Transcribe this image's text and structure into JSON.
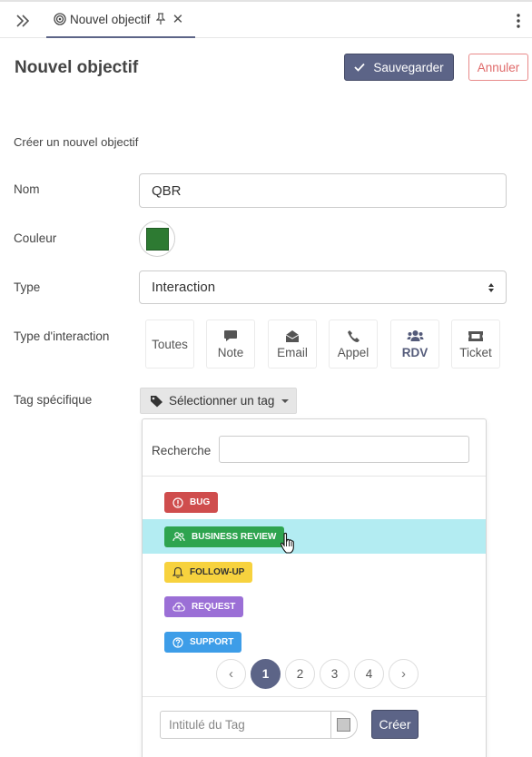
{
  "tab": {
    "label": "Nouvel objectif"
  },
  "page": {
    "title": "Nouvel objectif"
  },
  "actions": {
    "save": "Sauvegarder",
    "cancel": "Annuler"
  },
  "form": {
    "subtitle": "Créer un nouvel objectif",
    "name_label": "Nom",
    "name_value": "QBR",
    "color_label": "Couleur",
    "color_value": "#2d7a32",
    "type_label": "Type",
    "type_value": "Interaction",
    "interaction_label": "Type d'interaction",
    "interaction_types": [
      {
        "label": "Toutes",
        "icon": "none",
        "selected": false
      },
      {
        "label": "Note",
        "icon": "comment-icon",
        "selected": false
      },
      {
        "label": "Email",
        "icon": "envelope-open-icon",
        "selected": false
      },
      {
        "label": "Appel",
        "icon": "phone-icon",
        "selected": false
      },
      {
        "label": "RDV",
        "icon": "users-icon",
        "selected": true
      },
      {
        "label": "Ticket",
        "icon": "ticket-icon",
        "selected": false
      }
    ],
    "tag_label": "Tag spécifique",
    "tag_button": "Sélectionner un tag"
  },
  "tag_dropdown": {
    "search_label": "Recherche",
    "search_value": "",
    "tags": [
      {
        "label": "BUG",
        "icon": "exclamation-circle-icon",
        "color": "#cf4d4d",
        "text_color": "#ffffff"
      },
      {
        "label": "BUSINESS REVIEW",
        "icon": "users-icon",
        "color": "#2ea44f",
        "text_color": "#ffffff",
        "hovered": true
      },
      {
        "label": "FOLLOW-UP",
        "icon": "bell-icon",
        "color": "#f7d23e",
        "text_color": "#333333"
      },
      {
        "label": "REQUEST",
        "icon": "cloud-upload-icon",
        "color": "#9b6fd6",
        "text_color": "#ffffff"
      },
      {
        "label": "SUPPORT",
        "icon": "question-circle-icon",
        "color": "#3d9de8",
        "text_color": "#ffffff"
      }
    ],
    "pagination": {
      "prev": "‹",
      "pages": [
        "1",
        "2",
        "3",
        "4"
      ],
      "current": "1",
      "next": "›"
    },
    "new_tag_placeholder": "Intitulé du Tag",
    "create_button": "Créer"
  },
  "colors": {
    "primary": "#5c6487",
    "danger": "#e06b6b",
    "highlight": "#b3ecf2"
  }
}
